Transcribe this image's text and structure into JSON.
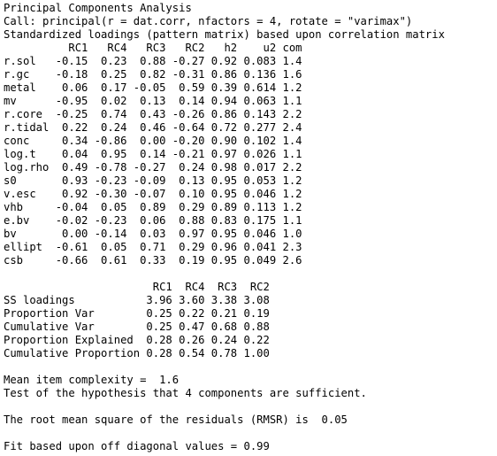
{
  "window": {
    "type": "R console output",
    "background_color": "#ffffff",
    "text_color": "#000000"
  },
  "output": {
    "lines": [
      "Principal Components Analysis",
      "Call: principal(r = dat.corr, nfactors = 4, rotate = \"varimax\")",
      "Standardized loadings (pattern matrix) based upon correlation matrix",
      "          RC1   RC4   RC3   RC2   h2    u2 com",
      "r.sol   -0.15  0.23  0.88 -0.27 0.92 0.083 1.4",
      "r.gc    -0.18  0.25  0.82 -0.31 0.86 0.136 1.6",
      "metal    0.06  0.17 -0.05  0.59 0.39 0.614 1.2",
      "mv      -0.95  0.02  0.13  0.14 0.94 0.063 1.1",
      "r.core  -0.25  0.74  0.43 -0.26 0.86 0.143 2.2",
      "r.tidal  0.22  0.24  0.46 -0.64 0.72 0.277 2.4",
      "conc     0.34 -0.86  0.00 -0.20 0.90 0.102 1.4",
      "log.t    0.04  0.95  0.14 -0.21 0.97 0.026 1.1",
      "log.rho  0.49 -0.78 -0.27  0.24 0.98 0.017 2.2",
      "s0       0.93 -0.23 -0.09  0.13 0.95 0.053 1.2",
      "v.esc    0.92 -0.30 -0.07  0.10 0.95 0.046 1.2",
      "vhb     -0.04  0.05  0.89  0.29 0.89 0.113 1.2",
      "e.bv    -0.02 -0.23  0.06  0.88 0.83 0.175 1.1",
      "bv       0.00 -0.14  0.03  0.97 0.95 0.046 1.0",
      "ellipt  -0.61  0.05  0.71  0.29 0.96 0.041 2.3",
      "csb     -0.66  0.61  0.33  0.19 0.95 0.049 2.6",
      "",
      "                       RC1  RC4  RC3  RC2",
      "SS loadings           3.96 3.60 3.38 3.08",
      "Proportion Var        0.25 0.22 0.21 0.19",
      "Cumulative Var        0.25 0.47 0.68 0.88",
      "Proportion Explained  0.28 0.26 0.24 0.22",
      "Cumulative Proportion 0.28 0.54 0.78 1.00",
      "",
      "Mean item complexity =  1.6",
      "Test of the hypothesis that 4 components are sufficient.",
      "",
      "The root mean square of the residuals (RMSR) is  0.05",
      "",
      "Fit based upon off diagonal values = 0.99"
    ]
  }
}
